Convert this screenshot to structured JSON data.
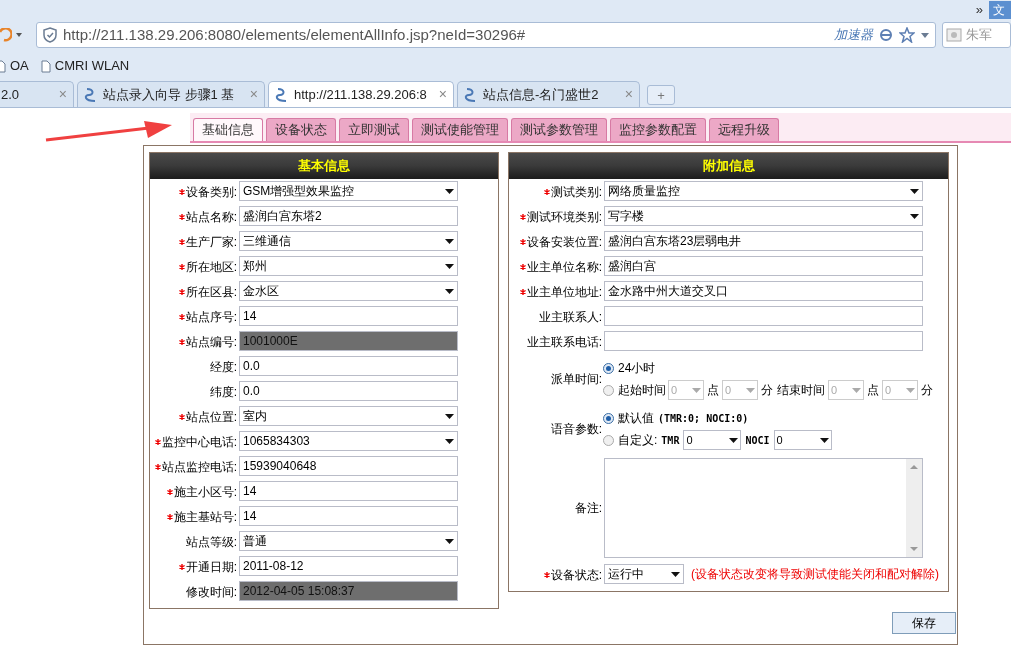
{
  "browser": {
    "menu_chevron": "»",
    "menu_file": "文",
    "url": "http://211.138.29.206:8080/elements/elementAllInfo.jsp?neId=30296#",
    "accelerator": "加速器",
    "search_placeholder": "朱军",
    "bookmarks": [
      "OA",
      "CMRI WLAN"
    ],
    "tabs": [
      {
        "title": "2.0",
        "selected": false,
        "close": "×"
      },
      {
        "title": "站点录入向导 步骤1 基",
        "selected": false,
        "close": "×"
      },
      {
        "title": "http://211.138.29.206:8",
        "selected": true,
        "close": "×"
      },
      {
        "title": "站点信息-名门盛世2",
        "selected": false,
        "close": "×"
      }
    ],
    "new_tab": "+"
  },
  "page_tabs": [
    {
      "label": "基础信息",
      "selected": true
    },
    {
      "label": "设备状态",
      "selected": false
    },
    {
      "label": "立即测试",
      "selected": false
    },
    {
      "label": "测试使能管理",
      "selected": false
    },
    {
      "label": "测试参数管理",
      "selected": false
    },
    {
      "label": "监控参数配置",
      "selected": false
    },
    {
      "label": "远程升级",
      "selected": false
    }
  ],
  "basic_info": {
    "title": "基本信息",
    "fields": [
      {
        "label": "设备类别:",
        "required": true,
        "kind": "select",
        "value": "GSM增强型效果监控"
      },
      {
        "label": "站点名称:",
        "required": true,
        "kind": "text",
        "value": "盛润白宫东塔2"
      },
      {
        "label": "生产厂家:",
        "required": true,
        "kind": "select",
        "value": "三维通信"
      },
      {
        "label": "所在地区:",
        "required": true,
        "kind": "select",
        "value": "郑州"
      },
      {
        "label": "所在区县:",
        "required": true,
        "kind": "select",
        "value": "金水区"
      },
      {
        "label": "站点序号:",
        "required": true,
        "kind": "text",
        "value": "14"
      },
      {
        "label": "站点编号:",
        "required": true,
        "kind": "readonly",
        "value": "1001000E"
      },
      {
        "label": "经度:",
        "required": false,
        "kind": "text",
        "value": "0.0"
      },
      {
        "label": "纬度:",
        "required": false,
        "kind": "text",
        "value": "0.0"
      },
      {
        "label": "站点位置:",
        "required": true,
        "kind": "select",
        "value": "室内"
      },
      {
        "label": "监控中心电话:",
        "required": true,
        "kind": "select",
        "value": "1065834303"
      },
      {
        "label": "站点监控电话:",
        "required": true,
        "kind": "text",
        "value": "15939040648"
      },
      {
        "label": "施主小区号:",
        "required": true,
        "kind": "text",
        "value": "14"
      },
      {
        "label": "施主基站号:",
        "required": true,
        "kind": "text",
        "value": "14"
      },
      {
        "label": "站点等级:",
        "required": false,
        "kind": "select",
        "value": "普通"
      },
      {
        "label": "开通日期:",
        "required": true,
        "kind": "text",
        "value": "2011-08-12"
      },
      {
        "label": "修改时间:",
        "required": false,
        "kind": "readonly",
        "value": "2012-04-05 15:08:37"
      }
    ]
  },
  "extra_info": {
    "title": "附加信息",
    "fields": [
      {
        "label": "测试类别:",
        "required": true,
        "kind": "select",
        "value": "网络质量监控"
      },
      {
        "label": "测试环境类别:",
        "required": true,
        "kind": "select",
        "value": "写字楼"
      },
      {
        "label": "设备安装位置:",
        "required": true,
        "kind": "text",
        "value": "盛润白宫东塔23层弱电井"
      },
      {
        "label": "业主单位名称:",
        "required": true,
        "kind": "text",
        "value": "盛润白宫"
      },
      {
        "label": "业主单位地址:",
        "required": true,
        "kind": "text",
        "value": "金水路中州大道交叉口"
      },
      {
        "label": "业主联系人:",
        "required": false,
        "kind": "text"
      },
      {
        "label": "业主联系电话:",
        "required": false,
        "kind": "text"
      },
      {
        "label": "派单时间:",
        "required": false,
        "kind": "radio_group",
        "options": [
          {
            "label": "24小时",
            "selected": true
          },
          {
            "label": "起始时间",
            "selected": false,
            "parts": [
              {
                "kind": "select",
                "value": "0",
                "disabled": true
              },
              {
                "kind": "word",
                "text": "点"
              },
              {
                "kind": "select",
                "value": "0",
                "disabled": true
              },
              {
                "kind": "word",
                "text": "分"
              },
              {
                "kind": "word",
                "text": "结束时间"
              },
              {
                "kind": "select",
                "value": "0",
                "disabled": true
              },
              {
                "kind": "word",
                "text": "点"
              },
              {
                "kind": "select",
                "value": "0",
                "disabled": true
              },
              {
                "kind": "word",
                "text": "分"
              }
            ]
          }
        ]
      },
      {
        "label": "语音参数:",
        "required": false,
        "kind": "radio_group",
        "options": [
          {
            "label": "默认值",
            "selected": true,
            "parts": [
              {
                "kind": "mono",
                "text": "(TMR:0; NOCI:0)"
              }
            ]
          },
          {
            "label": "自定义:",
            "selected": false,
            "parts": [
              {
                "kind": "mono",
                "text": "TMR"
              },
              {
                "kind": "select",
                "value": "0",
                "disabled": false
              },
              {
                "kind": "mono",
                "text": "NOCI"
              },
              {
                "kind": "select",
                "value": "0",
                "disabled": false
              }
            ]
          }
        ]
      },
      {
        "label": "备注:",
        "required": false,
        "kind": "textarea"
      },
      {
        "label": "设备状态:",
        "required": true,
        "kind": "select_note",
        "value": "运行中",
        "note": "(设备状态改变将导致测试使能关闭和配对解除)"
      }
    ]
  },
  "save_button": "保存"
}
